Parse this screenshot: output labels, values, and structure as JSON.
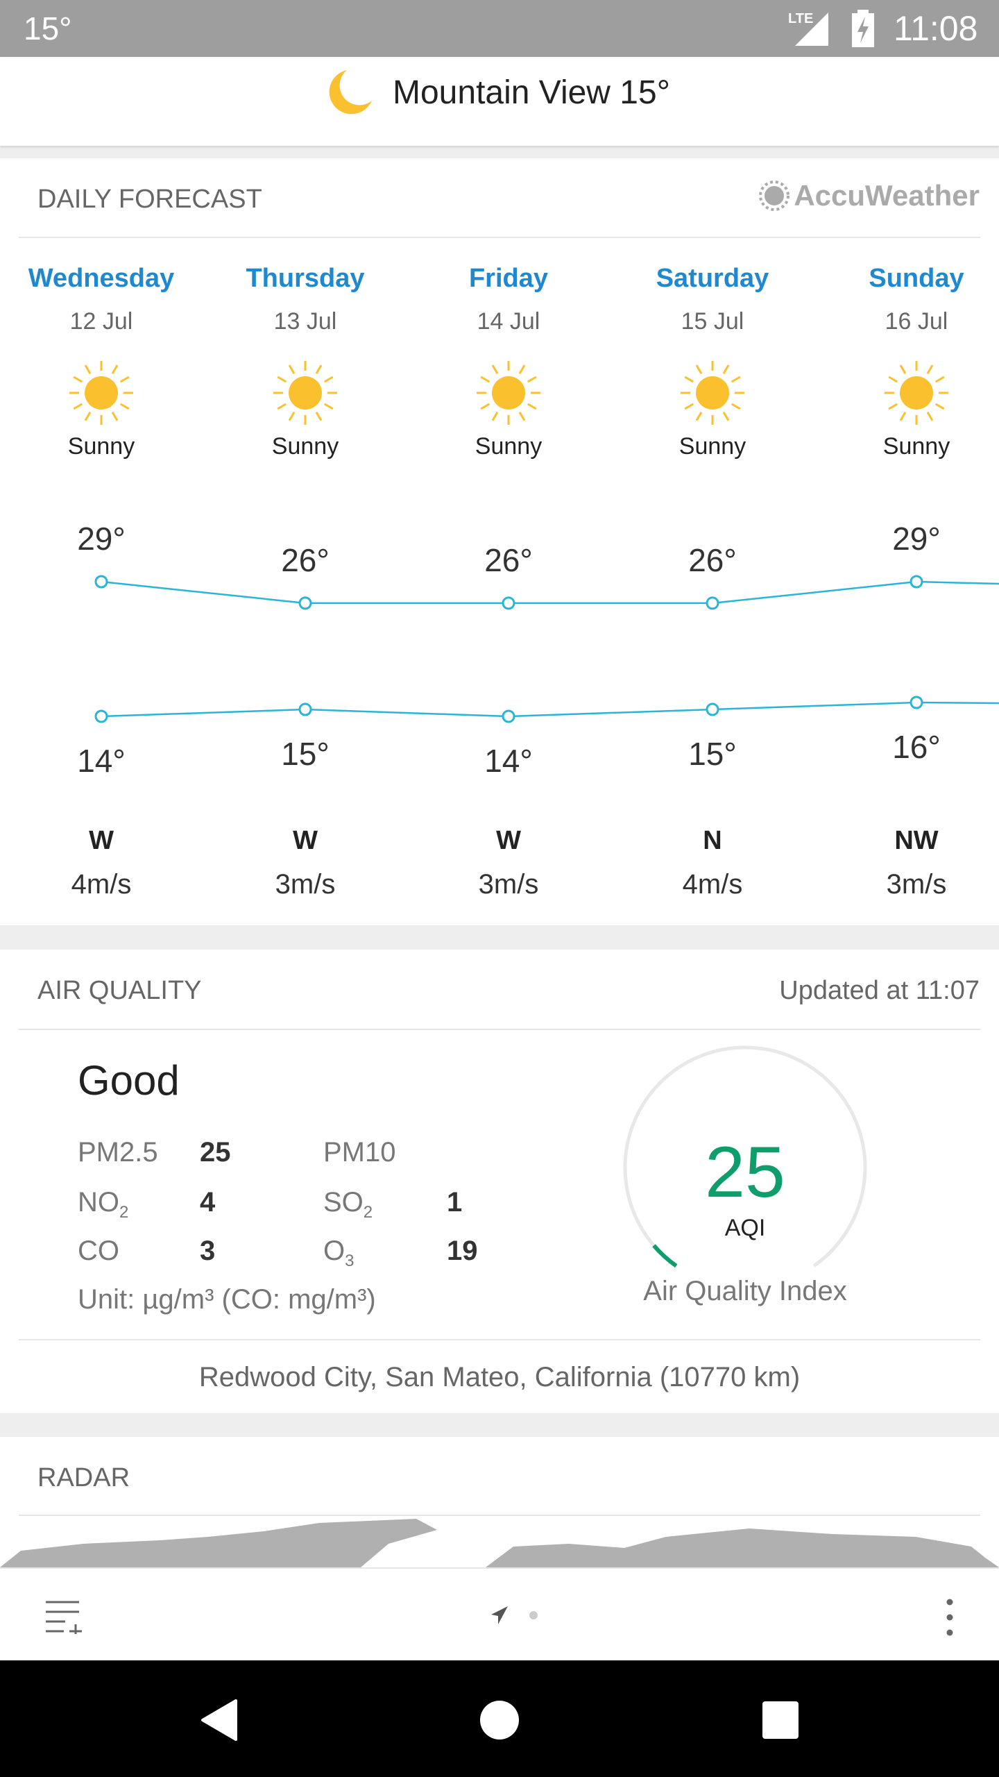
{
  "status_bar": {
    "notification_temp": "15°",
    "network": "LTE",
    "time": "11:08"
  },
  "header": {
    "icon": "moon-icon",
    "title": "Mountain View 15°"
  },
  "daily_forecast": {
    "heading": "DAILY FORECAST",
    "provider": "AccuWeather",
    "days": [
      {
        "name": "Wednesday",
        "date": "12 Jul",
        "condition": "Sunny",
        "high": 29,
        "high_label": "29°",
        "low": 14,
        "low_label": "14°",
        "wind_dir": "W",
        "wind_speed": "4m/s"
      },
      {
        "name": "Thursday",
        "date": "13 Jul",
        "condition": "Sunny",
        "high": 26,
        "high_label": "26°",
        "low": 15,
        "low_label": "15°",
        "wind_dir": "W",
        "wind_speed": "3m/s"
      },
      {
        "name": "Friday",
        "date": "14 Jul",
        "condition": "Sunny",
        "high": 26,
        "high_label": "26°",
        "low": 14,
        "low_label": "14°",
        "wind_dir": "W",
        "wind_speed": "3m/s"
      },
      {
        "name": "Saturday",
        "date": "15 Jul",
        "condition": "Sunny",
        "high": 26,
        "high_label": "26°",
        "low": 15,
        "low_label": "15°",
        "wind_dir": "N",
        "wind_speed": "4m/s"
      },
      {
        "name": "Sunday",
        "date": "16 Jul",
        "condition": "Sunny",
        "high": 29,
        "high_label": "29°",
        "low": 16,
        "low_label": "16°",
        "wind_dir": "NW",
        "wind_speed": "3m/s"
      }
    ],
    "line_color": "#29b6d6"
  },
  "air_quality": {
    "heading": "AIR QUALITY",
    "updated": "Updated at 11:07",
    "level": "Good",
    "pollutants": {
      "pm25_label": "PM2.5",
      "pm25": "25",
      "pm10_label": "PM10",
      "no2_label": "NO",
      "no2_sub": "2",
      "no2": "4",
      "so2_label": "SO",
      "so2_sub": "2",
      "so2": "1",
      "co_label": "CO",
      "co": "3",
      "o3_label": "O",
      "o3_sub": "3",
      "o3": "19"
    },
    "unit": "Unit: µg/m³ (CO: mg/m³)",
    "aqi": 25,
    "aqi_value": "25",
    "aqi_label": "AQI",
    "gauge_label": "Air Quality Index",
    "aqi_color": "#0f9d6b",
    "station": "Redwood City, San Mateo, California (10770 km)"
  },
  "radar": {
    "heading": "RADAR"
  }
}
